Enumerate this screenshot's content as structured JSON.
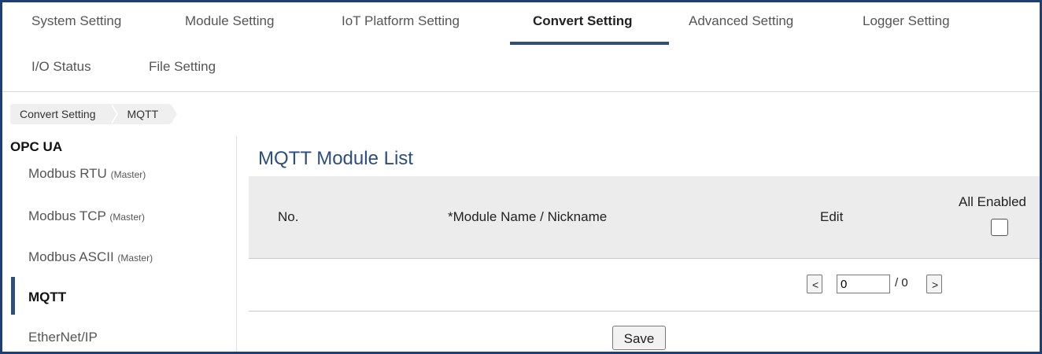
{
  "nav": {
    "tabs": [
      {
        "label": "System Setting"
      },
      {
        "label": "Module Setting"
      },
      {
        "label": "IoT Platform Setting"
      },
      {
        "label": "Convert Setting"
      },
      {
        "label": "Advanced Setting"
      },
      {
        "label": "Logger Setting"
      },
      {
        "label": "I/O Status"
      },
      {
        "label": "File Setting"
      }
    ],
    "active_tab": "Convert Setting"
  },
  "breadcrumb": [
    "Convert Setting",
    "MQTT"
  ],
  "sidebar": {
    "title": "OPC UA",
    "items": [
      {
        "label": "Modbus RTU",
        "suffix": "(Master)"
      },
      {
        "label": "Modbus TCP",
        "suffix": "(Master)"
      },
      {
        "label": "Modbus ASCII",
        "suffix": "(Master)"
      },
      {
        "label": "MQTT",
        "suffix": ""
      },
      {
        "label": "EtherNet/IP",
        "suffix": ""
      }
    ],
    "active_item": "MQTT"
  },
  "main": {
    "title": "MQTT Module List",
    "columns": {
      "no": "No.",
      "name": "*Module Name / Nickname",
      "edit": "Edit",
      "all_enabled": "All Enabled"
    },
    "all_enabled_checked": false,
    "pager": {
      "prev": "<",
      "next": ">",
      "current": "0",
      "total": "/ 0"
    },
    "save_label": "Save"
  },
  "colors": {
    "accent": "#2c4f7c",
    "frame": "#1f3e75",
    "header_bg": "#ececec"
  }
}
